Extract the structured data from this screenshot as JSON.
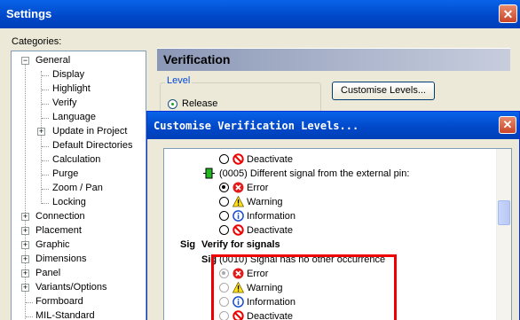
{
  "window": {
    "title": "Settings",
    "close_glyph": "✕"
  },
  "categories": {
    "label": "Categories:",
    "items": [
      {
        "label": "General",
        "expander": "−"
      },
      {
        "label": "Display"
      },
      {
        "label": "Highlight"
      },
      {
        "label": "Verify"
      },
      {
        "label": "Language"
      },
      {
        "label": "Update in Project",
        "expander": "+"
      },
      {
        "label": "Default Directories"
      },
      {
        "label": "Calculation"
      },
      {
        "label": "Purge"
      },
      {
        "label": "Zoom / Pan"
      },
      {
        "label": "Locking"
      },
      {
        "label": "Connection",
        "expander": "+"
      },
      {
        "label": "Placement",
        "expander": "+"
      },
      {
        "label": "Graphic",
        "expander": "+"
      },
      {
        "label": "Dimensions",
        "expander": "+"
      },
      {
        "label": "Panel",
        "expander": "+"
      },
      {
        "label": "Variants/Options",
        "expander": "+"
      },
      {
        "label": "Formboard"
      },
      {
        "label": "MIL-Standard"
      }
    ]
  },
  "panel": {
    "heading": "Verification",
    "level_legend": "Level",
    "release_label": "Release",
    "customise_button": "Customise Levels..."
  },
  "dialog": {
    "title": "Customise Verification Levels...",
    "close_glyph": "✕",
    "rows": [
      {
        "kind": "option",
        "label": "Deactivate",
        "icon": "deactivate-icon"
      },
      {
        "kind": "header",
        "tag": "",
        "icon": "green-pin-icon",
        "label": "(0005) Different signal from the external pin:"
      },
      {
        "kind": "option",
        "label": "Error",
        "icon": "error-icon",
        "selected": true
      },
      {
        "kind": "option",
        "label": "Warning",
        "icon": "warning-icon"
      },
      {
        "kind": "option",
        "label": "Information",
        "icon": "information-icon"
      },
      {
        "kind": "option",
        "label": "Deactivate",
        "icon": "deactivate-icon"
      },
      {
        "kind": "section",
        "tag": "Sig",
        "label": "Verify for signals"
      },
      {
        "kind": "header",
        "tag": "Sig",
        "label": "(0010) Signal has no other occurrence"
      },
      {
        "kind": "option",
        "label": "Error",
        "icon": "error-icon",
        "selected": true,
        "disabled": true
      },
      {
        "kind": "option",
        "label": "Warning",
        "icon": "warning-icon",
        "disabled": true
      },
      {
        "kind": "option",
        "label": "Information",
        "icon": "information-icon",
        "disabled": true
      },
      {
        "kind": "option",
        "label": "Deactivate",
        "icon": "deactivate-icon",
        "disabled": true
      }
    ]
  },
  "colors": {
    "title_bar": "#0047c8",
    "highlight_box": "#e00000",
    "panel_heading_bg": "#a9b3cb"
  }
}
